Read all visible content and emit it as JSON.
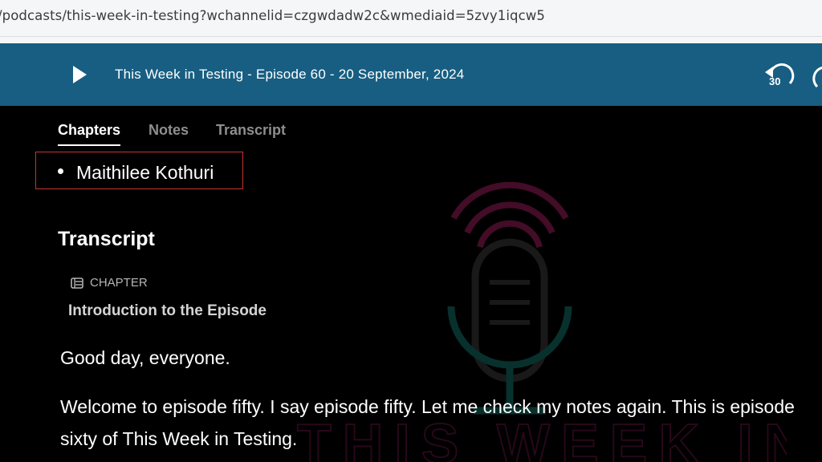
{
  "browser": {
    "url": "/podcasts/this-week-in-testing?wchannelid=czgwdadw2c&wmediaid=5zvy1iqcw5"
  },
  "player": {
    "title": "This Week in Testing - Episode 60 - 20 September, 2024",
    "rewind_label": "30",
    "colors": {
      "bar": "#175e82"
    }
  },
  "tabs": [
    {
      "label": "Chapters",
      "active": true
    },
    {
      "label": "Notes",
      "active": false
    },
    {
      "label": "Transcript",
      "active": false
    }
  ],
  "chapters": [
    {
      "label": "Maithilee Kothuri"
    }
  ],
  "transcript": {
    "heading": "Transcript",
    "chapter_tag": "CHAPTER",
    "chapter_title": "Introduction to the Episode",
    "paragraphs": [
      "Good day, everyone.",
      "Welcome to episode fifty. I say episode fifty. Let me check my notes again. This is episode",
      "sixty of This Week in Testing."
    ]
  }
}
